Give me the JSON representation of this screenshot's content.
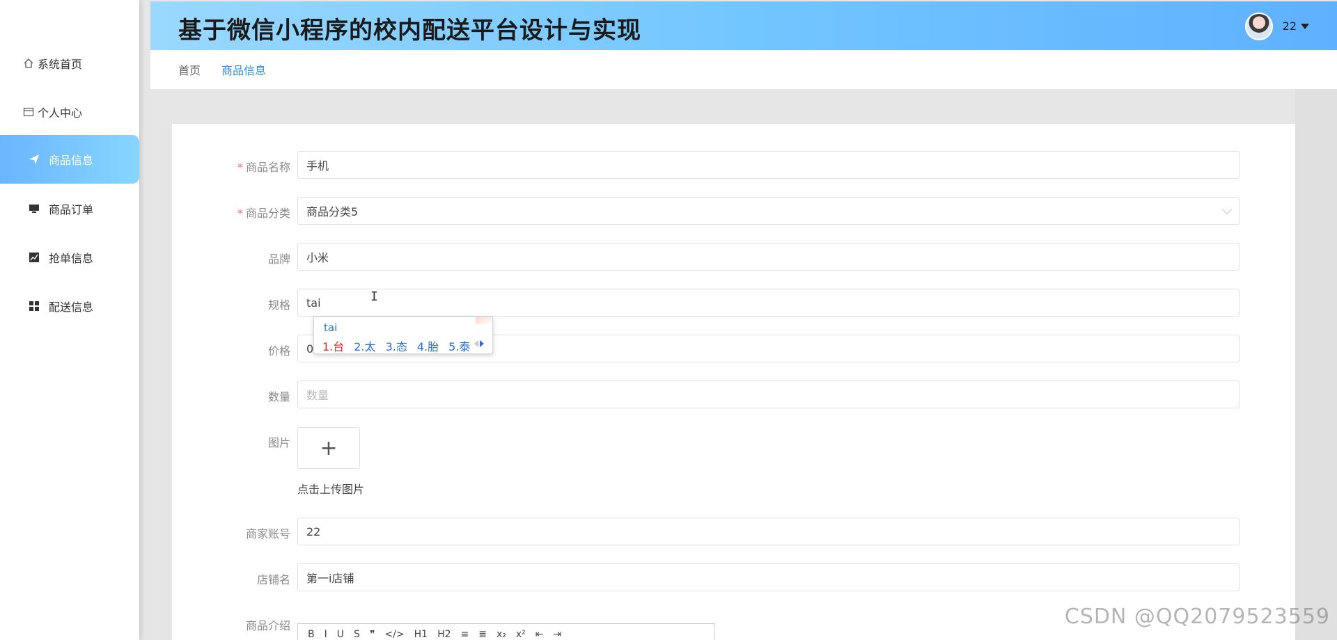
{
  "app": {
    "title": "基于微信小程序的校内配送平台设计与实现"
  },
  "header": {
    "username": "22"
  },
  "sidebar": {
    "items": [
      {
        "label": "系统首页",
        "icon": "home-icon"
      },
      {
        "label": "个人中心",
        "icon": "profile-icon"
      },
      {
        "label": "商品信息",
        "icon": "paper-plane-icon",
        "active": true
      },
      {
        "label": "商品订单",
        "icon": "monitor-icon"
      },
      {
        "label": "抢单信息",
        "icon": "chart-icon"
      },
      {
        "label": "配送信息",
        "icon": "grid-icon"
      }
    ]
  },
  "breadcrumb": {
    "home": "首页",
    "current": "商品信息"
  },
  "form": {
    "name": {
      "label": "商品名称",
      "value": "手机",
      "required": true
    },
    "category": {
      "label": "商品分类",
      "value": "商品分类5",
      "required": true
    },
    "brand": {
      "label": "品牌",
      "value": "小米"
    },
    "spec": {
      "label": "规格",
      "value": "tai"
    },
    "price": {
      "label": "价格",
      "value": "0"
    },
    "quantity": {
      "label": "数量",
      "placeholder": "数量"
    },
    "image": {
      "label": "图片",
      "tip": "点击上传图片"
    },
    "merchant": {
      "label": "商家账号",
      "value": "22"
    },
    "shop": {
      "label": "店铺名",
      "value": "第一i店铺"
    },
    "intro": {
      "label": "商品介绍"
    }
  },
  "ime": {
    "composition": "tai",
    "candidates": [
      "1.台",
      "2.太",
      "3.态",
      "4.胎",
      "5.泰"
    ]
  },
  "editor": {
    "toolbar": [
      "B",
      "I",
      "U",
      "S",
      "❞",
      "</>",
      "H1",
      "H2",
      "≡",
      "≣",
      "x₂",
      "x²",
      "⇤",
      "⇥"
    ]
  },
  "watermark": "CSDN @QQ2079523559"
}
